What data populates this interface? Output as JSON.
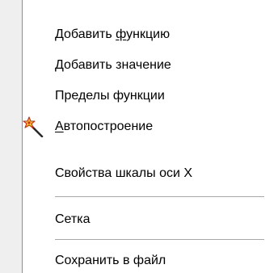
{
  "menu": {
    "items": [
      {
        "pre": "Добавить ",
        "u": "ф",
        "post": "ункцию"
      },
      {
        "pre": "Добавить значение",
        "u": "",
        "post": ""
      },
      {
        "pre": "Пределы функции",
        "u": "",
        "post": ""
      },
      {
        "pre": "",
        "u": "А",
        "post": "втопостроение",
        "icon": "magic-wand-icon"
      },
      {
        "pre": "Свойства шкалы оси X",
        "u": "",
        "post": ""
      },
      {
        "pre": "Сетка",
        "u": "",
        "post": ""
      },
      {
        "pre": "Сохранить в файл",
        "u": "",
        "post": ""
      }
    ]
  },
  "colors": {
    "background": "#ffffff",
    "icon_column": "#efefef",
    "separator": "#a8a8a8",
    "text": "#000000"
  }
}
